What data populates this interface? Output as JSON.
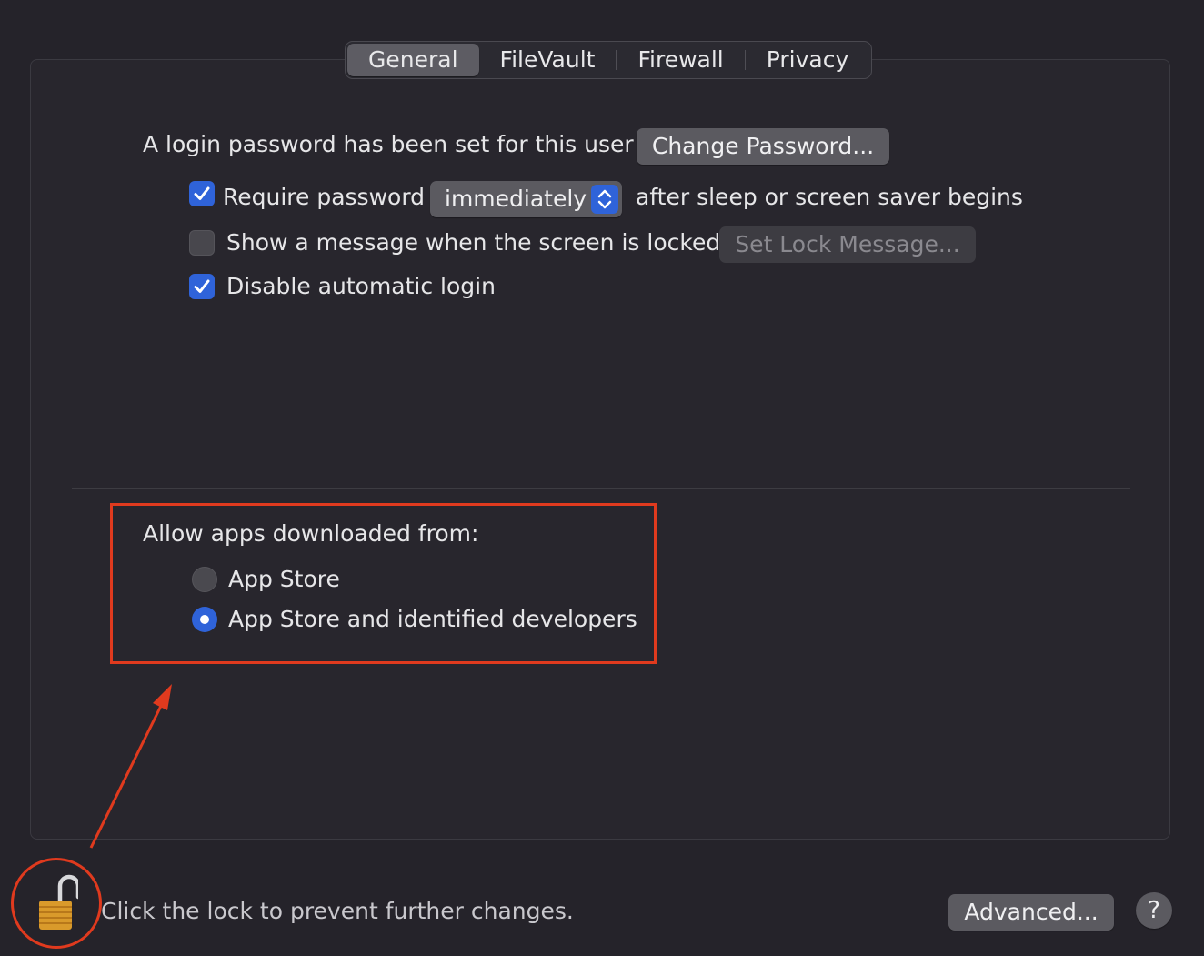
{
  "tabs": [
    {
      "label": "General",
      "active": true
    },
    {
      "label": "FileVault",
      "active": false
    },
    {
      "label": "Firewall",
      "active": false
    },
    {
      "label": "Privacy",
      "active": false
    }
  ],
  "general": {
    "login_text": "A login password has been set for this user",
    "change_password_button": "Change Password...",
    "require_password": {
      "checked": true,
      "label": "Require password",
      "select_value": "immediately",
      "suffix": "after sleep or screen saver begins"
    },
    "show_message": {
      "checked": false,
      "label": "Show a message when the screen is locked",
      "button": "Set Lock Message..."
    },
    "disable_auto_login": {
      "checked": true,
      "label": "Disable automatic login"
    }
  },
  "allow_apps": {
    "heading": "Allow apps downloaded from:",
    "options": [
      {
        "label": "App Store",
        "selected": false
      },
      {
        "label": "App Store and identified developers",
        "selected": true
      }
    ]
  },
  "footer": {
    "lock_text": "Click the lock to prevent further changes.",
    "advanced_button": "Advanced...",
    "help_label": "?"
  },
  "colors": {
    "accent": "#2f63d9",
    "annotation": "#e03a1e",
    "background": "#25232a"
  }
}
